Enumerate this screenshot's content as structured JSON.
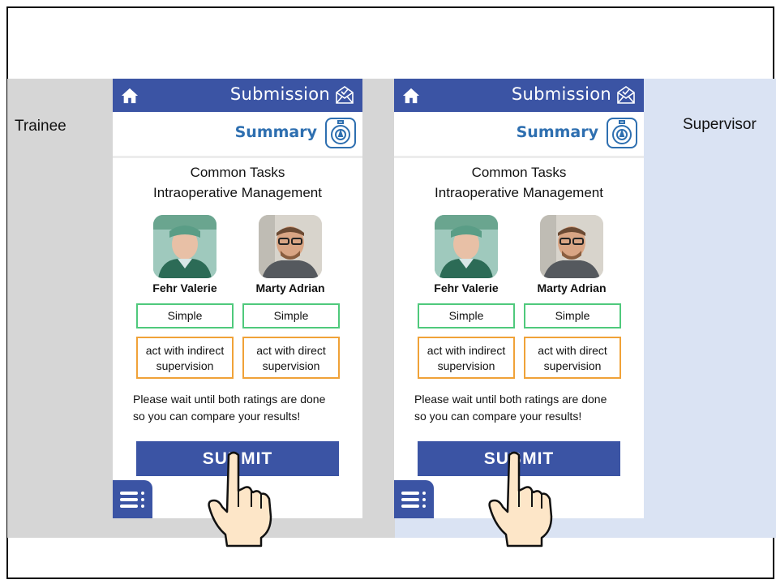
{
  "labels": {
    "left": "Trainee",
    "right": "Supervisor"
  },
  "phones": [
    {
      "header_title": "Submission",
      "summary_label": "Summary",
      "task_line1": "Common Tasks",
      "task_line2": "Intraoperative Management",
      "people": [
        {
          "name": "Fehr Valerie",
          "rating": "Simple",
          "supervision": [
            "act with indirect",
            "supervision"
          ]
        },
        {
          "name": "Marty Adrian",
          "rating": "Simple",
          "supervision": [
            "act with direct",
            "supervision"
          ]
        }
      ],
      "wait_line1": "Please wait until both ratings are done",
      "wait_line2": "so you can compare your results!",
      "submit_label": "SUBMIT"
    },
    {
      "header_title": "Submission",
      "summary_label": "Summary",
      "task_line1": "Common Tasks",
      "task_line2": "Intraoperative Management",
      "people": [
        {
          "name": "Fehr Valerie",
          "rating": "Simple",
          "supervision": [
            "act with indirect",
            "supervision"
          ]
        },
        {
          "name": "Marty Adrian",
          "rating": "Simple",
          "supervision": [
            "act with direct",
            "supervision"
          ]
        }
      ],
      "wait_line1": "Please wait until both ratings are done",
      "wait_line2": "so you can compare your results!",
      "submit_label": "SUBMIT"
    }
  ],
  "icons": [
    "home-icon",
    "envelope-check-icon",
    "stopwatch-icon",
    "menu-icon",
    "pointing-hand-icon"
  ],
  "colors": {
    "primary": "#3b54a4",
    "accent": "#2e6fb0",
    "green": "#4fc97c",
    "orange": "#f0a238",
    "trainee_bg": "#d6d6d6",
    "supervisor_bg": "#dae3f3"
  }
}
